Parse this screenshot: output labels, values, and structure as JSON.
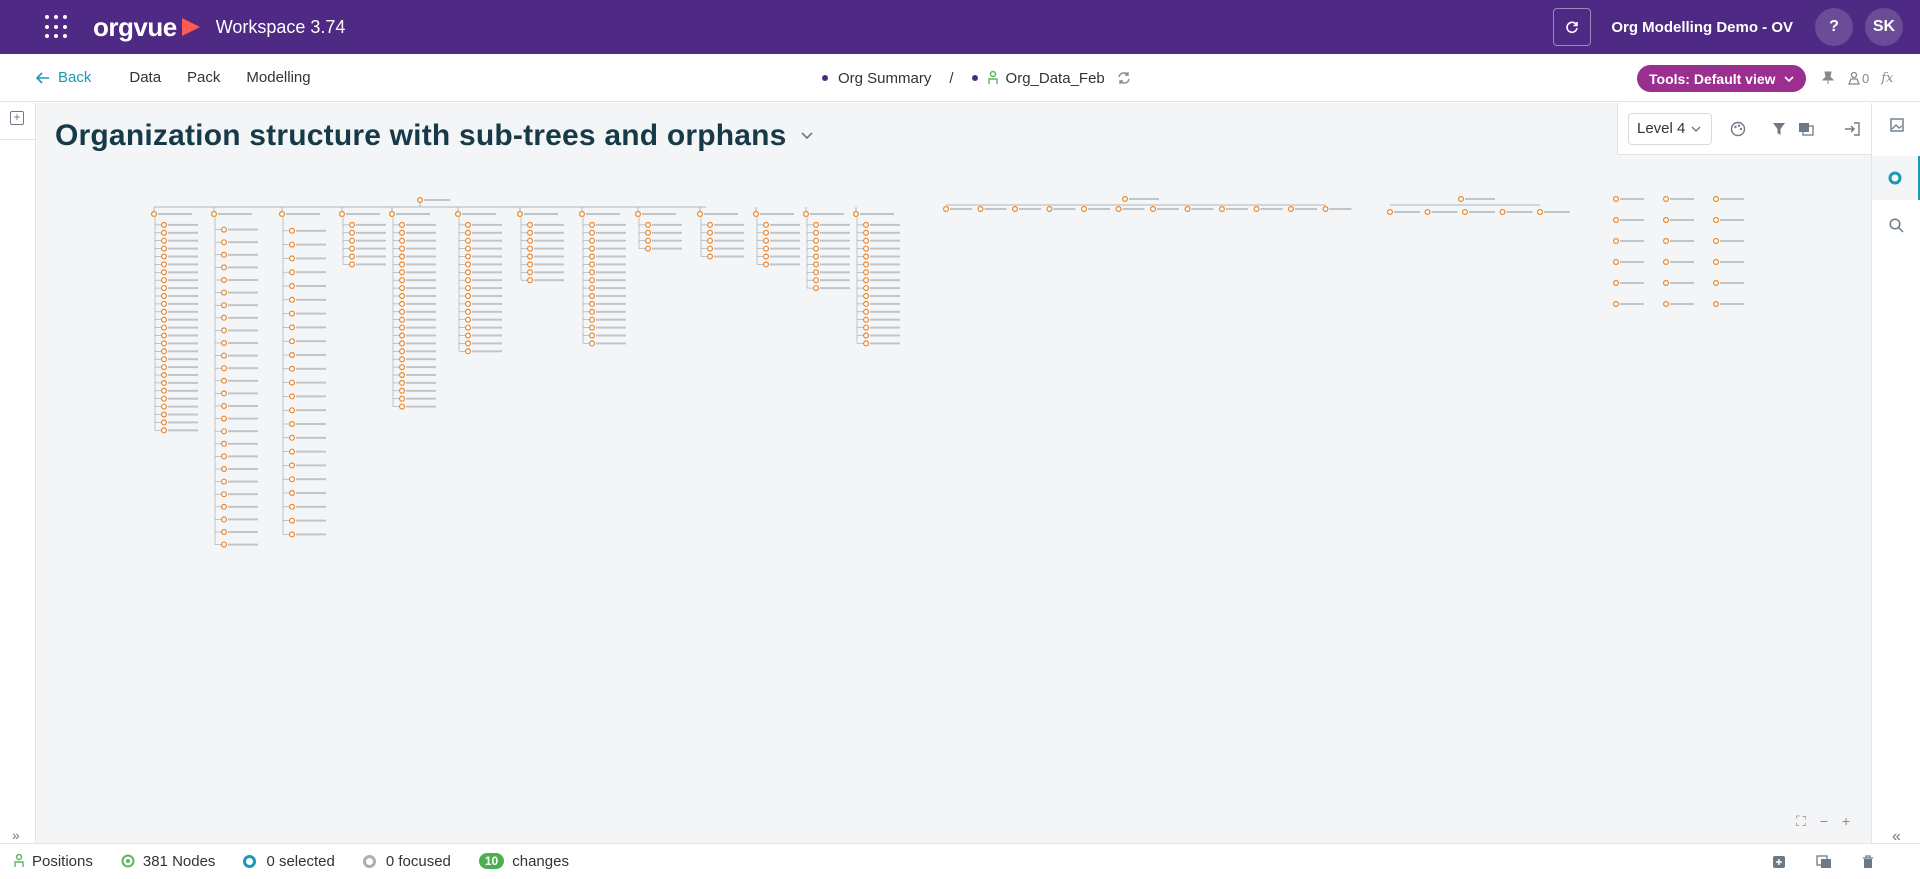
{
  "topbar": {
    "brand": "orgvue",
    "workspace": "Workspace  3.74",
    "org_name": "Org Modelling Demo - OV",
    "help": "?",
    "user_initials": "SK"
  },
  "subnav": {
    "back": "Back",
    "menu": [
      "Data",
      "Pack",
      "Modelling"
    ],
    "crumb1": "Org Summary",
    "crumb_sep": "/",
    "crumb2": "Org_Data_Feb",
    "tools_label": "Tools: Default view",
    "pin_count": "0",
    "fx": "fx"
  },
  "canvas": {
    "title": "Organization structure with sub-trees and orphans",
    "level": "Level 4"
  },
  "statusbar": {
    "positions": "Positions",
    "nodes": "381 Nodes",
    "selected": "0 selected",
    "focused": "0 focused",
    "changes_count": "10",
    "changes_label": "changes"
  },
  "colors": {
    "topbar": "#4e2a84",
    "accent": "#1b9ab3",
    "tools": "#9b2f8f",
    "node": "#e8852b",
    "changes": "#4caf50"
  },
  "icons": [
    "apps-grid-icon",
    "refresh-icon",
    "arrow-left-icon",
    "person-icon",
    "sync-icon",
    "chevron-down-icon",
    "pin-icon",
    "user-count-icon",
    "palette-icon",
    "filter-icon",
    "layers-icon",
    "export-icon",
    "image-icon",
    "circle-icon",
    "search-icon",
    "fit-icon",
    "zoom-out-icon",
    "zoom-in-icon",
    "collapse-icon",
    "add-icon",
    "duplicate-icon",
    "delete-icon"
  ]
}
